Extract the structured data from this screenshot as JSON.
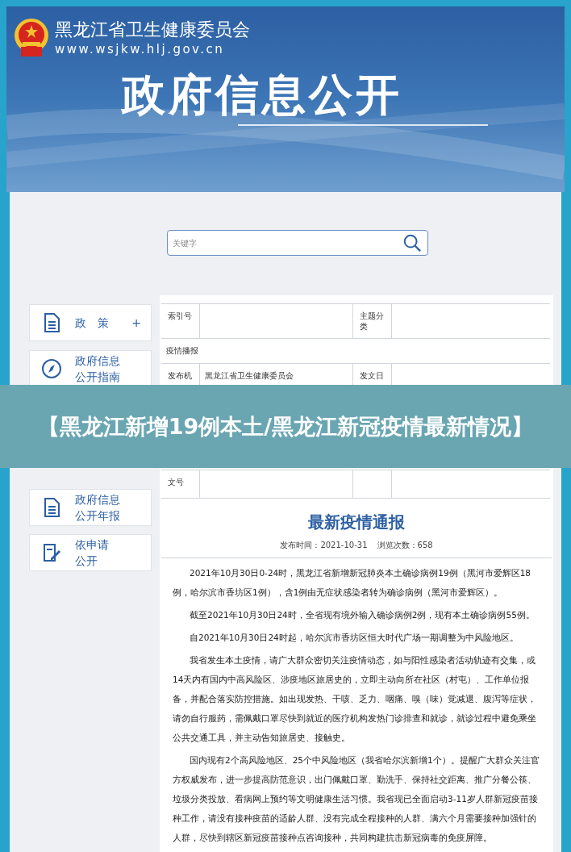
{
  "header": {
    "org_name": "黑龙江省卫生健康委员会",
    "url": "www.wsjkw.hlj.gov.cn",
    "title": "政府信息公开"
  },
  "search": {
    "placeholder": "关键字"
  },
  "sidebar": {
    "items": [
      {
        "lines": [
          "政　策"
        ],
        "toggle": "+"
      },
      {
        "lines": [
          "政府信息",
          "公开指南"
        ]
      },
      {
        "lines": [
          "政府信息",
          "公开年报"
        ]
      },
      {
        "lines": [
          "依申请",
          "公开"
        ]
      }
    ]
  },
  "meta_table": {
    "rows": [
      {
        "kind": "pair",
        "label": "索引号",
        "label_2": "主题分类"
      },
      {
        "kind": "full",
        "value": "疫情播报"
      },
      {
        "kind": "pair",
        "label": "发布机",
        "value": "黑龙江省卫生健康委员会",
        "label_2": "发文日"
      },
      {
        "kind": "pair",
        "label": "文号"
      }
    ]
  },
  "article": {
    "title": "最新疫情通报",
    "publish_time": "发布时间：2021-10-31",
    "views": "浏览次数：658",
    "paragraphs": [
      "2021年10月30日0-24时，黑龙江省新增新冠肺炎本土确诊病例19例（黑河市爱辉区18例，哈尔滨市香坊区1例），含1例由无症状感染者转为确诊病例（黑河市爱辉区）。",
      "截至2021年10月30日24时，全省现有境外输入确诊病例2例，现有本土确诊病例55例。",
      "自2021年10月30日24时起，哈尔滨市香坊区恒大时代广场一期调整为中风险地区。",
      "我省发生本土疫情，请广大群众密切关注疫情动态，如与阳性感染者活动轨迹有交集，或14天内有国内中高风险区、涉疫地区旅居史的，立即主动向所在社区（村屯）、工作单位报备，并配合落实防控措施。如出现发热、干咳、乏力、咽痛、嗅（味）觉减退、腹泻等症状，请勿自行服药，需佩戴口罩尽快到就近的医疗机构发热门诊排查和就诊，就诊过程中避免乘坐公共交通工具，并主动告知旅居史、接触史。",
      "国内现有2个高风险地区、25个中风险地区（我省哈尔滨新增1个）。提醒广大群众关注官方权威发布，进一步提高防范意识，出门佩戴口罩、勤洗手、保持社交距离、推广分餐公筷、垃圾分类投放、看病网上预约等文明健康生活习惯。我省现已全面启动3-11岁人群新冠疫苗接种工作，请没有接种疫苗的适龄人群、没有完成全程接种的人群、满六个月需要接种加强针的人群，尽快到辖区新冠疫苗接种点咨询接种，共同构建抗击新冠病毒的免疫屏障。"
    ]
  },
  "banner": {
    "text": "【黑龙江新增19例本土/黑龙江新冠疫情最新情况】"
  }
}
